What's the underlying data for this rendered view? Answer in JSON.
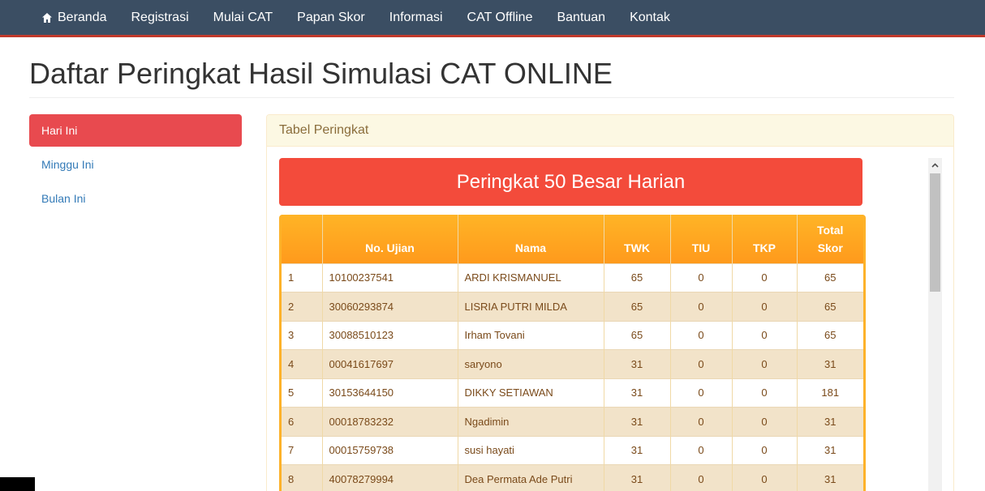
{
  "nav": {
    "items": [
      {
        "label": "Beranda",
        "icon": "home-icon"
      },
      {
        "label": "Registrasi"
      },
      {
        "label": "Mulai CAT"
      },
      {
        "label": "Papan Skor"
      },
      {
        "label": "Informasi"
      },
      {
        "label": "CAT Offline"
      },
      {
        "label": "Bantuan"
      },
      {
        "label": "Kontak"
      }
    ]
  },
  "page": {
    "title": "Daftar Peringkat Hasil Simulasi CAT ONLINE"
  },
  "sidebar": {
    "items": [
      {
        "label": "Hari Ini",
        "active": true
      },
      {
        "label": "Minggu Ini"
      },
      {
        "label": "Bulan Ini"
      }
    ]
  },
  "panel": {
    "heading": "Tabel Peringkat",
    "banner": "Peringkat 50 Besar Harian"
  },
  "table": {
    "headers": [
      "",
      "No. Ujian",
      "Nama",
      "TWK",
      "TIU",
      "TKP",
      "Total Skor"
    ],
    "total_header_line1": "Total",
    "total_header_line2": "Skor",
    "rows": [
      [
        "1",
        "10100237541",
        "ARDI KRISMANUEL",
        "65",
        "0",
        "0",
        "65"
      ],
      [
        "2",
        "30060293874",
        "LISRIA PUTRI MILDA",
        "65",
        "0",
        "0",
        "65"
      ],
      [
        "3",
        "30088510123",
        "Irham Tovani",
        "65",
        "0",
        "0",
        "65"
      ],
      [
        "4",
        "00041617697",
        "saryono",
        "31",
        "0",
        "0",
        "31"
      ],
      [
        "5",
        "30153644150",
        "DIKKY SETIAWAN",
        "31",
        "0",
        "0",
        "181"
      ],
      [
        "6",
        "00018783232",
        "Ngadimin",
        "31",
        "0",
        "0",
        "31"
      ],
      [
        "7",
        "00015759738",
        "susi hayati",
        "31",
        "0",
        "0",
        "31"
      ],
      [
        "8",
        "40078279994",
        "Dea Permata Ade Putri",
        "31",
        "0",
        "0",
        "31"
      ]
    ]
  },
  "colors": {
    "navbar": "#3b4e63",
    "accent_red": "#e84a4f",
    "banner": "#f34b3b",
    "table_header": "#ffa721"
  }
}
